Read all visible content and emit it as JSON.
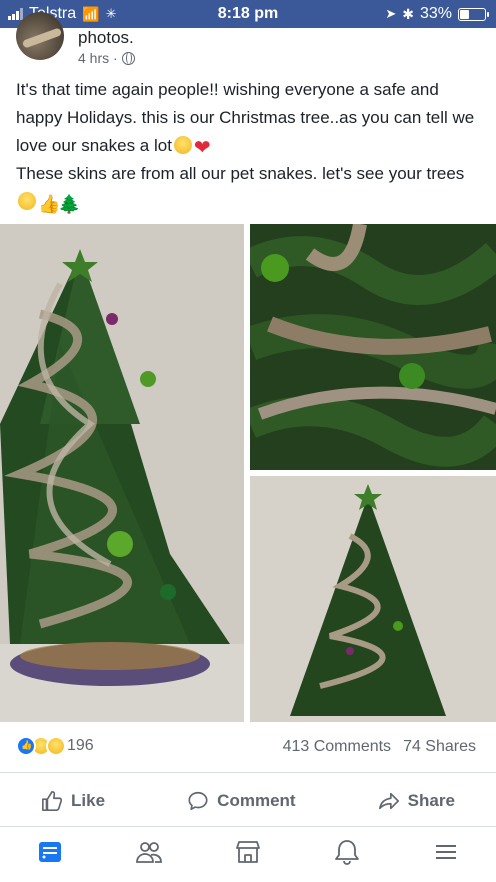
{
  "status_bar": {
    "carrier": "Telstra",
    "time": "8:18 pm",
    "battery": "33%",
    "battery_level": 0.33
  },
  "post": {
    "title_fragment": "photos.",
    "time_ago": "4 hrs ·",
    "text_line1": "It's that time again people!! wishing everyone a safe and happy Holidays. this is our Christmas tree..as you can tell we love our snakes a lot",
    "text_line2": "These skins are from all our pet snakes. let's see your trees",
    "reactions_count": "196",
    "comments": "413 Comments",
    "shares": "74 Shares"
  },
  "actions": {
    "like": "Like",
    "comment": "Comment",
    "share": "Share"
  },
  "icons": {
    "post_emoji_1": "laughing-emoji",
    "post_emoji_2": "heart-emoji",
    "post_emoji_3": "tongue-out-emoji",
    "post_emoji_4": "thumbs-up-emoji",
    "post_emoji_5": "christmas-tree-emoji"
  },
  "colors": {
    "brand": "#3b5998",
    "link_blue": "#1877f2",
    "muted_text": "#616770"
  }
}
